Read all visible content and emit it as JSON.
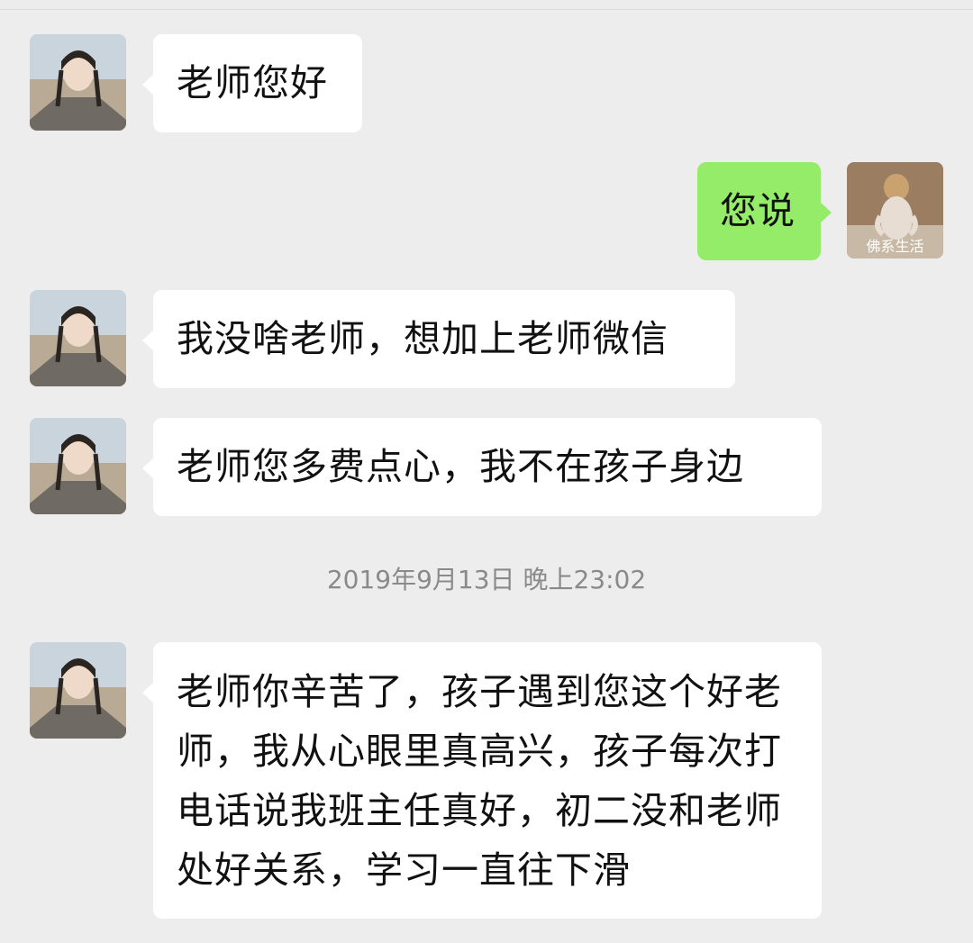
{
  "chat": {
    "messages": [
      {
        "sender": "contact",
        "text": "老师您好"
      },
      {
        "sender": "me",
        "text": "您说"
      },
      {
        "sender": "contact",
        "text": "我没啥老师，想加上老师微信"
      },
      {
        "sender": "contact",
        "text": "老师您多费点心，我不在孩子身边"
      },
      {
        "sender": "contact",
        "text": "老师你辛苦了，孩子遇到您这个好老师，我从心眼里真高兴，孩子每次打电话说我班主任真好，初二没和老师处好关系，学习一直往下滑"
      }
    ],
    "timestamp": "2019年9月13日 晚上23:02",
    "my_avatar_caption": "佛系生活"
  },
  "colors": {
    "background": "#ededed",
    "incoming_bubble": "#ffffff",
    "outgoing_bubble": "#95ec69",
    "timestamp_text": "#8a8a8a"
  },
  "icons": {
    "contact_avatar": "girl-photo-avatar",
    "my_avatar": "meditating-dog-avatar"
  }
}
